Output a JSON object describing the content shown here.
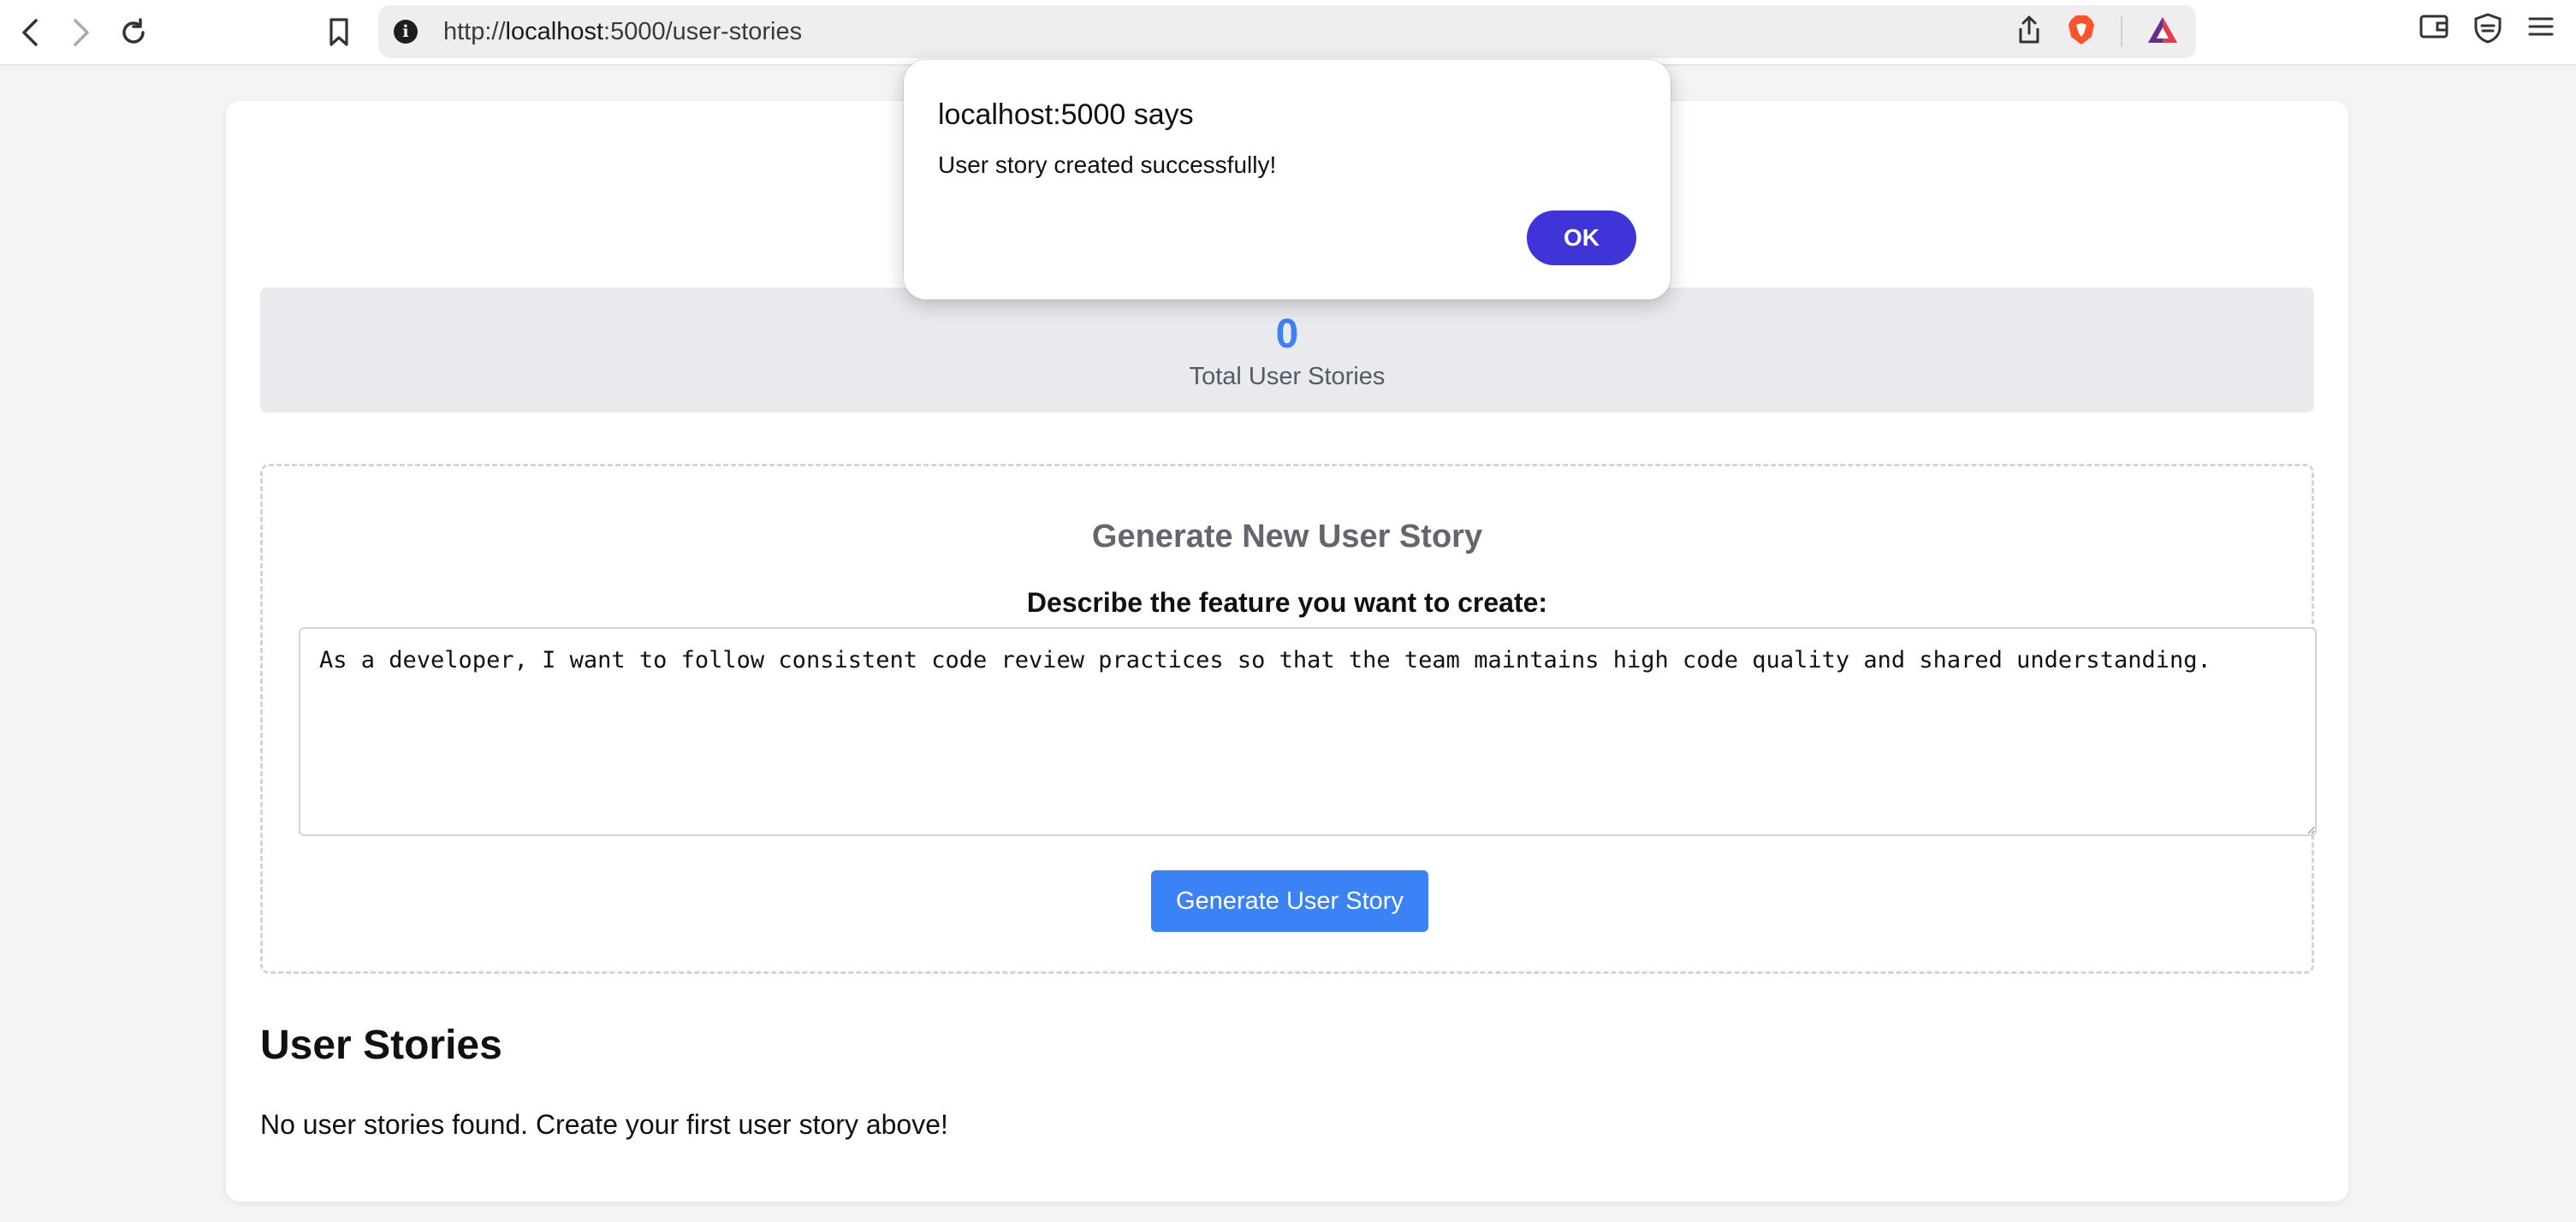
{
  "browser": {
    "url_prefix": "http://",
    "url_host": "localhost",
    "url_path": ":5000/user-stories",
    "icons": [
      "back-icon",
      "forward-icon",
      "reload-icon",
      "bookmark-icon",
      "site-info-icon",
      "share-icon",
      "brave-shields-icon",
      "brave-rewards-icon",
      "wallet-icon",
      "vpn-shield-icon",
      "menu-icon"
    ],
    "info_glyph": "i"
  },
  "stats": {
    "count": "0",
    "label": "Total User Stories"
  },
  "generator": {
    "title": "Generate New User Story",
    "prompt_label": "Describe the feature you want to create:",
    "textarea_value": "As a developer, I want to follow consistent code review practices so that the team maintains high code quality and shared understanding.",
    "button_label": "Generate User Story"
  },
  "stories": {
    "heading": "User Stories",
    "empty_message": "No user stories found. Create your first user story above!"
  },
  "dialog": {
    "title": "localhost:5000 says",
    "message": "User story created successfully!",
    "ok_label": "OK"
  },
  "colors": {
    "accent": "#3b82f6",
    "dialog_button": "#3f34d8",
    "page_background": "#f3f4f6"
  }
}
